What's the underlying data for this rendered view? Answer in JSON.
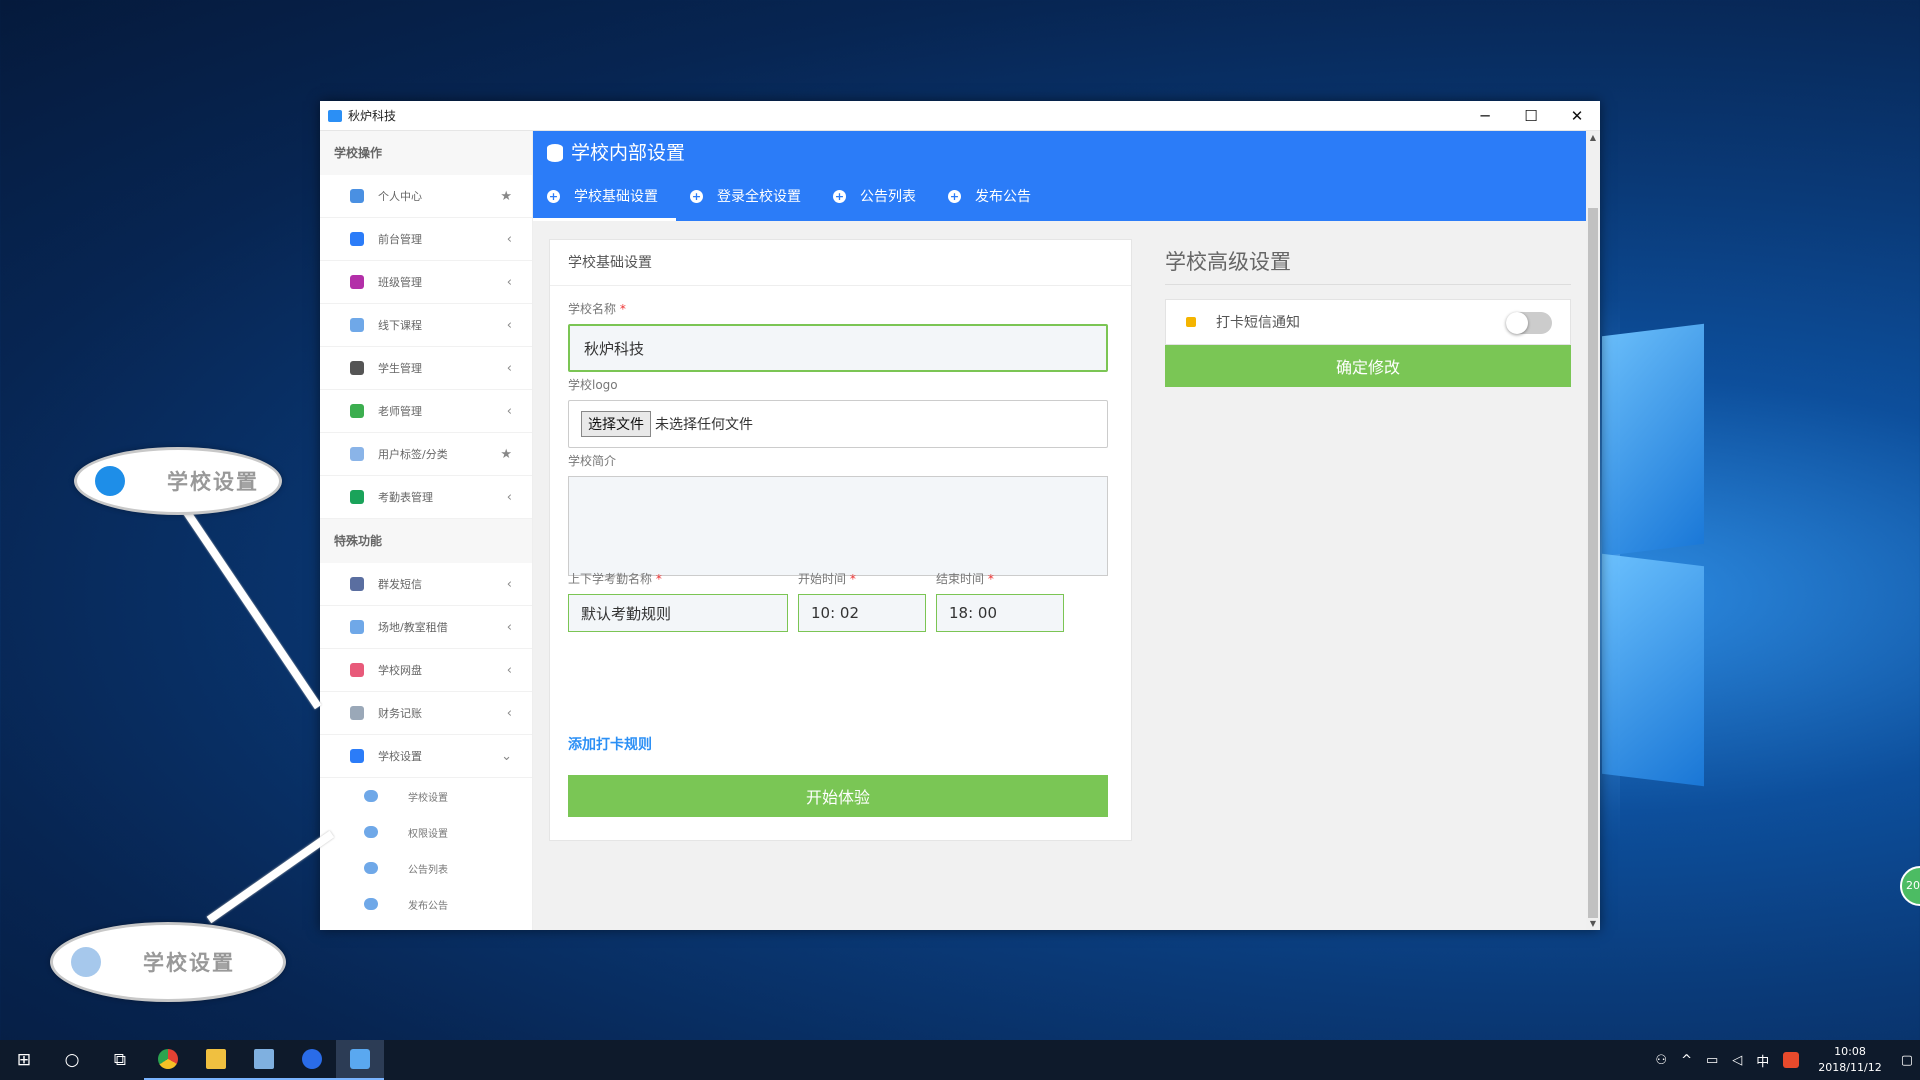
{
  "window": {
    "title": "秋炉科技",
    "minimize": "─",
    "maximize": "☐",
    "close": "✕"
  },
  "sidebar": {
    "section1": "学校操作",
    "items": [
      {
        "label": "个人中心",
        "icon": "home-icon",
        "color": "#4a90e2",
        "tail": "★"
      },
      {
        "label": "前台管理",
        "icon": "grid-icon",
        "color": "#2b7cf8",
        "tail": "‹"
      },
      {
        "label": "班级管理",
        "icon": "briefcase-icon",
        "color": "#b32fa8",
        "tail": "‹"
      },
      {
        "label": "线下课程",
        "icon": "clipboard-icon",
        "color": "#6fa8e8",
        "tail": "‹"
      },
      {
        "label": "学生管理",
        "icon": "person-icon",
        "color": "#555555",
        "tail": "‹"
      },
      {
        "label": "老师管理",
        "icon": "contact-icon",
        "color": "#3cae4f",
        "tail": "‹"
      },
      {
        "label": "用户标签/分类",
        "icon": "tag-icon",
        "color": "#8ab4e8",
        "tail": "★"
      },
      {
        "label": "考勤表管理",
        "icon": "clock-icon",
        "color": "#1aa35a",
        "tail": "‹"
      }
    ],
    "section2": "特殊功能",
    "items2": [
      {
        "label": "群发短信",
        "icon": "message-icon",
        "color": "#5a6ea0",
        "tail": "‹"
      },
      {
        "label": "场地/教室租借",
        "icon": "building-icon",
        "color": "#6fa8e8",
        "tail": "‹"
      },
      {
        "label": "学校网盘",
        "icon": "folder-icon",
        "color": "#e85a7a",
        "tail": "‹"
      },
      {
        "label": "财务记账",
        "icon": "document-icon",
        "color": "#9aa8b8",
        "tail": "‹"
      },
      {
        "label": "学校设置",
        "icon": "gear-icon",
        "color": "#2b7cf8",
        "tail": "⌄"
      }
    ],
    "subitems": [
      "学校设置",
      "权限设置",
      "公告列表",
      "发布公告"
    ]
  },
  "header": {
    "title": "学校内部设置",
    "tabs": [
      "学校基础设置",
      "登录全校设置",
      "公告列表",
      "发布公告"
    ]
  },
  "basic": {
    "card_title": "学校基础设置",
    "name_label": "学校名称",
    "name_value": "秋炉科技",
    "logo_label": "学校logo",
    "file_button": "选择文件",
    "file_status": "未选择任何文件",
    "intro_label": "学校简介",
    "rule_label": "上下学考勤名称",
    "start_label": "开始时间",
    "end_label": "结束时间",
    "rule_value": "默认考勤规则",
    "start_value": "10: 02",
    "end_value": "18: 00",
    "add_rule": "添加打卡规则",
    "submit": "开始体验",
    "required_mark": "*"
  },
  "advanced": {
    "title": "学校高级设置",
    "sms_label": "打卡短信通知",
    "sms_enabled": false,
    "confirm": "确定修改"
  },
  "callouts": {
    "top": "学校设置",
    "bottom": "学校设置"
  },
  "desktop_badge": "20",
  "taskbar": {
    "ime": "中",
    "time": "10:08",
    "date": "2018/11/12"
  }
}
